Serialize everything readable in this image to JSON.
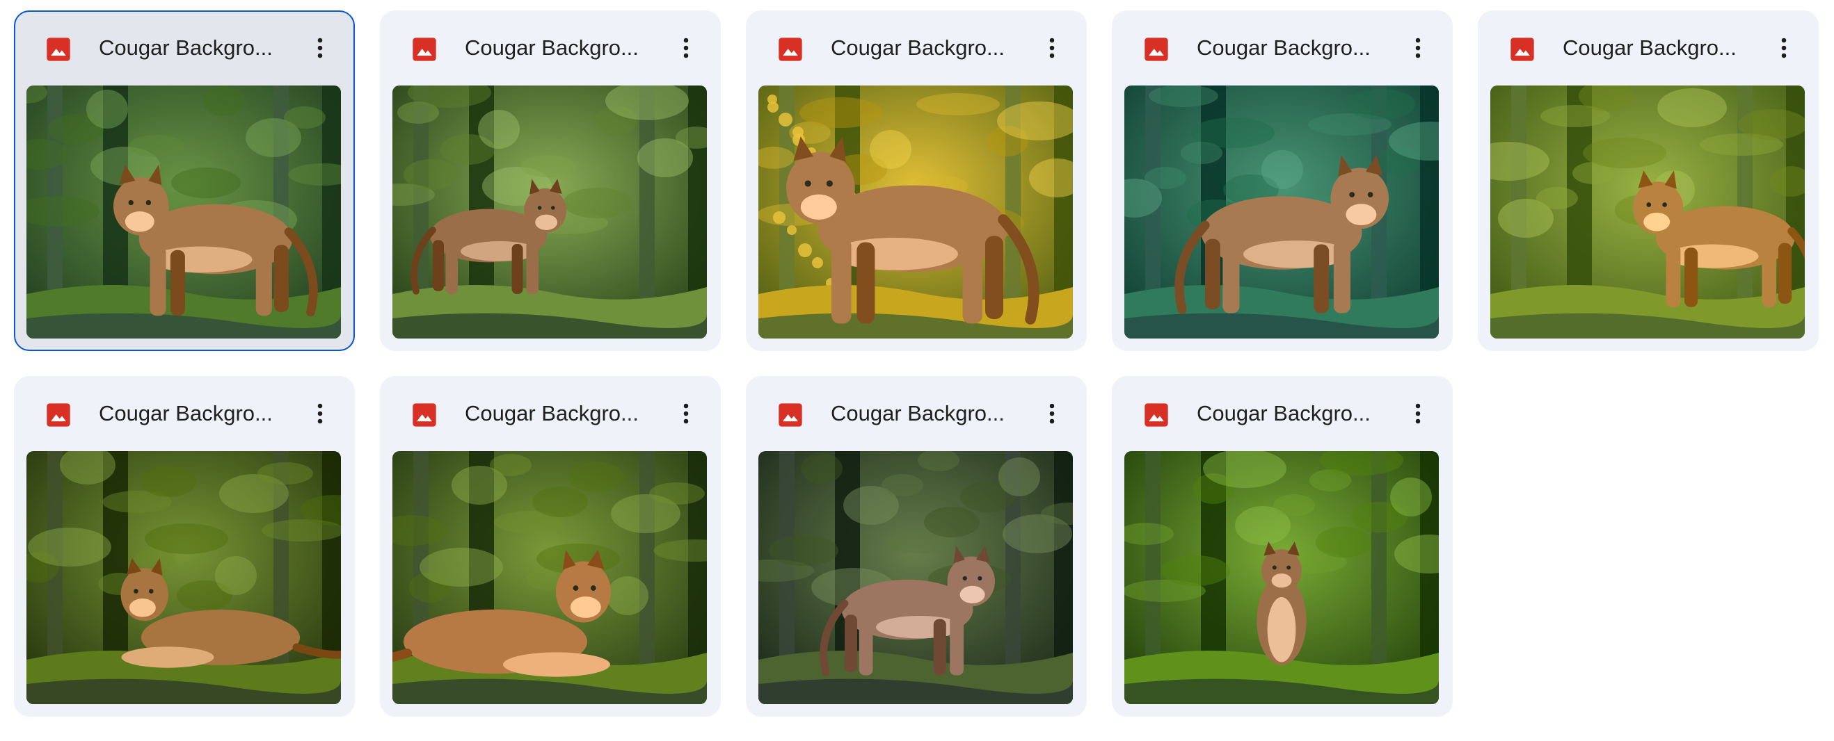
{
  "files": [
    {
      "name": "Cougar Backgro...",
      "selected": true,
      "scene": {
        "bg": "#2c4a2e",
        "light": "#5f8a3a",
        "cat": "#a8774a",
        "pose": "stand-right",
        "trees": "dark"
      }
    },
    {
      "name": "Cougar Backgro...",
      "selected": false,
      "scene": {
        "bg": "#2f4a23",
        "light": "#7ea04a",
        "cat": "#9a6e48",
        "pose": "stand-left-small",
        "trees": "fern"
      }
    },
    {
      "name": "Cougar Backgro...",
      "selected": false,
      "scene": {
        "bg": "#56681f",
        "light": "#d7b52c",
        "cat": "#b07b4a",
        "pose": "stand-right-big",
        "trees": "autumn"
      }
    },
    {
      "name": "Cougar Backgro...",
      "selected": false,
      "scene": {
        "bg": "#1c4a3e",
        "light": "#3e8a6a",
        "cat": "#a77a52",
        "pose": "stand-left",
        "trees": "teal"
      }
    },
    {
      "name": "Cougar Backgro...",
      "selected": false,
      "scene": {
        "bg": "#4b6320",
        "light": "#8ea83a",
        "cat": "#b9823f",
        "pose": "stand-front",
        "trees": "bright"
      }
    },
    {
      "name": "Cougar Backgro...",
      "selected": false,
      "scene": {
        "bg": "#2f3e1a",
        "light": "#6d8a2a",
        "cat": "#a87440",
        "pose": "lie-right",
        "trees": "moss"
      }
    },
    {
      "name": "Cougar Backgro...",
      "selected": false,
      "scene": {
        "bg": "#2f421f",
        "light": "#70902e",
        "cat": "#b87a44",
        "pose": "lie-left",
        "trees": "fern"
      }
    },
    {
      "name": "Cougar Backgro...",
      "selected": false,
      "scene": {
        "bg": "#263426",
        "light": "#5c7340",
        "cat": "#9c7660",
        "pose": "stand-front-small",
        "trees": "dark"
      }
    },
    {
      "name": "Cougar Backgro...",
      "selected": false,
      "scene": {
        "bg": "#2c4a18",
        "light": "#6fa02a",
        "cat": "#9d6f48",
        "pose": "sit-front",
        "trees": "moss"
      }
    }
  ],
  "icons": {
    "file_type": "image-file-icon",
    "more": "more-vert-icon"
  },
  "colors": {
    "card_bg": "#eff2f8",
    "selected_border": "#0b57d0",
    "icon_red": "#d93025",
    "text": "#1f1f1f"
  }
}
